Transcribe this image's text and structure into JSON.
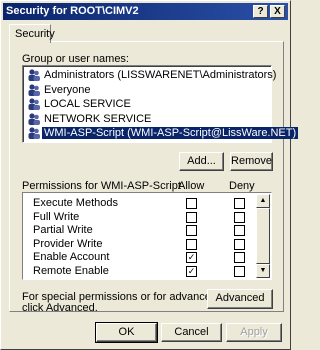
{
  "window": {
    "title": "Security for ROOT\\CIMV2",
    "help_label": "?",
    "close_label": "X"
  },
  "tabs": [
    {
      "label": "Security"
    }
  ],
  "groups": {
    "label": "Group or user names:",
    "items": [
      {
        "label": "Administrators (LISSWARENET\\Administrators)",
        "selected": false
      },
      {
        "label": "Everyone",
        "selected": false
      },
      {
        "label": "LOCAL SERVICE",
        "selected": false
      },
      {
        "label": "NETWORK SERVICE",
        "selected": false
      },
      {
        "label": "WMI-ASP-Script (WMI-ASP-Script@LissWare.NET)",
        "selected": true
      }
    ],
    "add_label": "Add...",
    "remove_label": "Remove"
  },
  "permissions": {
    "label": "Permissions for WMI-ASP-Script",
    "allow_label": "Allow",
    "deny_label": "Deny",
    "rows": [
      {
        "name": "Execute Methods",
        "allow": false,
        "deny": false
      },
      {
        "name": "Full Write",
        "allow": false,
        "deny": false
      },
      {
        "name": "Partial Write",
        "allow": false,
        "deny": false
      },
      {
        "name": "Provider Write",
        "allow": false,
        "deny": false
      },
      {
        "name": "Enable Account",
        "allow": true,
        "deny": false
      },
      {
        "name": "Remote Enable",
        "allow": true,
        "deny": false
      }
    ]
  },
  "advanced": {
    "text_line1": "For special permissions or for advanced settings,",
    "text_line2": "click Advanced.",
    "button_label": "Advanced"
  },
  "footer": {
    "ok_label": "OK",
    "cancel_label": "Cancel",
    "apply_label": "Apply"
  },
  "colors": {
    "titlebar": "#0a246a",
    "face": "#ece9d8",
    "selection": "#0a246a"
  }
}
